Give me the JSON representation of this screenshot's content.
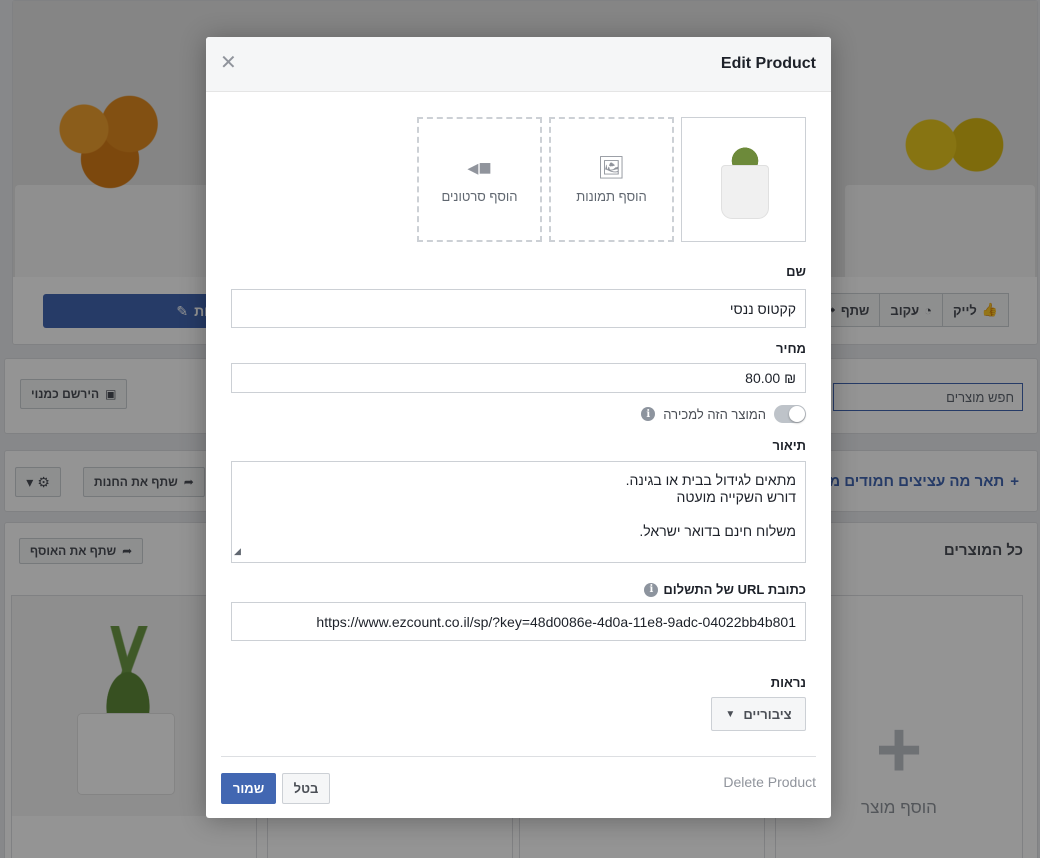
{
  "background": {
    "page_actions": {
      "like": "לייק",
      "follow": "עקוב",
      "share": "שתף"
    },
    "message_button": "עות",
    "subscribe_button": "הירשם כמנוי",
    "search_products_placeholder": "חפש מוצרים",
    "share_shop_button": "שתף את החנות",
    "describe_link": "תאר מה עציצים חמודים מ",
    "products_title": "כל המוצרים",
    "share_collection_button": "שתף את האוסף",
    "add_product_label": "הוסף מוצר",
    "accent_color": "#4267b2"
  },
  "dialog": {
    "title": "Edit Product",
    "close_icon": "close-icon",
    "media": {
      "add_photos_label": "הוסף תמונות",
      "add_videos_label": "הוסף סרטונים"
    },
    "name": {
      "label": "שם",
      "value": "קקטוס ננסי"
    },
    "price": {
      "label": "מחיר",
      "value": "₪ 80.00"
    },
    "for_sale_toggle": {
      "label": "המוצר הזה למכירה",
      "on": false
    },
    "description": {
      "label": "תיאור",
      "lines": [
        "מתאים לגידול בבית או בגינה.",
        "דורש השקייה מועטה",
        "",
        "משלוח חינם בדואר ישראל."
      ]
    },
    "checkout_url": {
      "label": "כתובת URL של התשלום",
      "value": "https://www.ezcount.co.il/sp/?key=48d0086e-4d0a-11e8-9adc-04022bb4b801"
    },
    "visibility": {
      "label": "נראות",
      "value": "ציבוריים"
    },
    "footer": {
      "delete_label": "Delete Product",
      "cancel_label": "בטל",
      "save_label": "שמור"
    },
    "primary_color": "#4267b2"
  }
}
